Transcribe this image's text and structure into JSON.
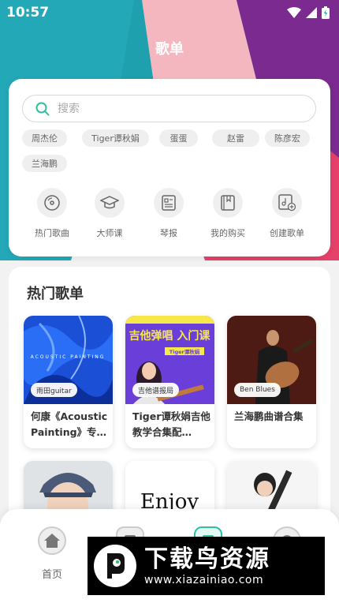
{
  "status_bar": {
    "time": "10:57"
  },
  "header": {
    "title": "歌单"
  },
  "search": {
    "placeholder": "搜索"
  },
  "tags": [
    "周杰伦",
    "Tiger谭秋娟",
    "蛋蛋",
    "赵雷",
    "陈彦宏",
    "兰海鹏"
  ],
  "quick_links": [
    {
      "label": "热门歌曲",
      "icon": "music-disc-icon"
    },
    {
      "label": "大师课",
      "icon": "graduation-cap-icon"
    },
    {
      "label": "琴报",
      "icon": "newspaper-icon"
    },
    {
      "label": "我的购买",
      "icon": "book-icon"
    },
    {
      "label": "创建歌单",
      "icon": "add-playlist-icon"
    }
  ],
  "hot_playlists": {
    "title": "热门歌单",
    "items": [
      {
        "badge": "雨田guitar",
        "name": "何康《Acoustic Painting》专…",
        "cover_text": "ACOUSTIC PAINTING"
      },
      {
        "badge": "吉他谱报局",
        "name": "Tiger谭秋娟吉他教学合集配…",
        "cover_text": "吉他弹唱 入门课",
        "cover_sub": "Tiger谭秋娟"
      },
      {
        "badge": "Ben Blues",
        "name": "兰海鹏曲谱合集"
      }
    ],
    "partial_cover_text": "Enjoy"
  },
  "tab_bar": {
    "items": [
      {
        "label": "首页",
        "icon": "home-icon"
      }
    ]
  },
  "watermark": {
    "title": "下载鸟资源",
    "url": "www.xiazainiao.com"
  },
  "colors": {
    "accent": "#2bc0a0",
    "hero_teal": "#1fa0ae",
    "hero_pink": "#e6416a",
    "hero_purple": "#7b2b8f"
  }
}
